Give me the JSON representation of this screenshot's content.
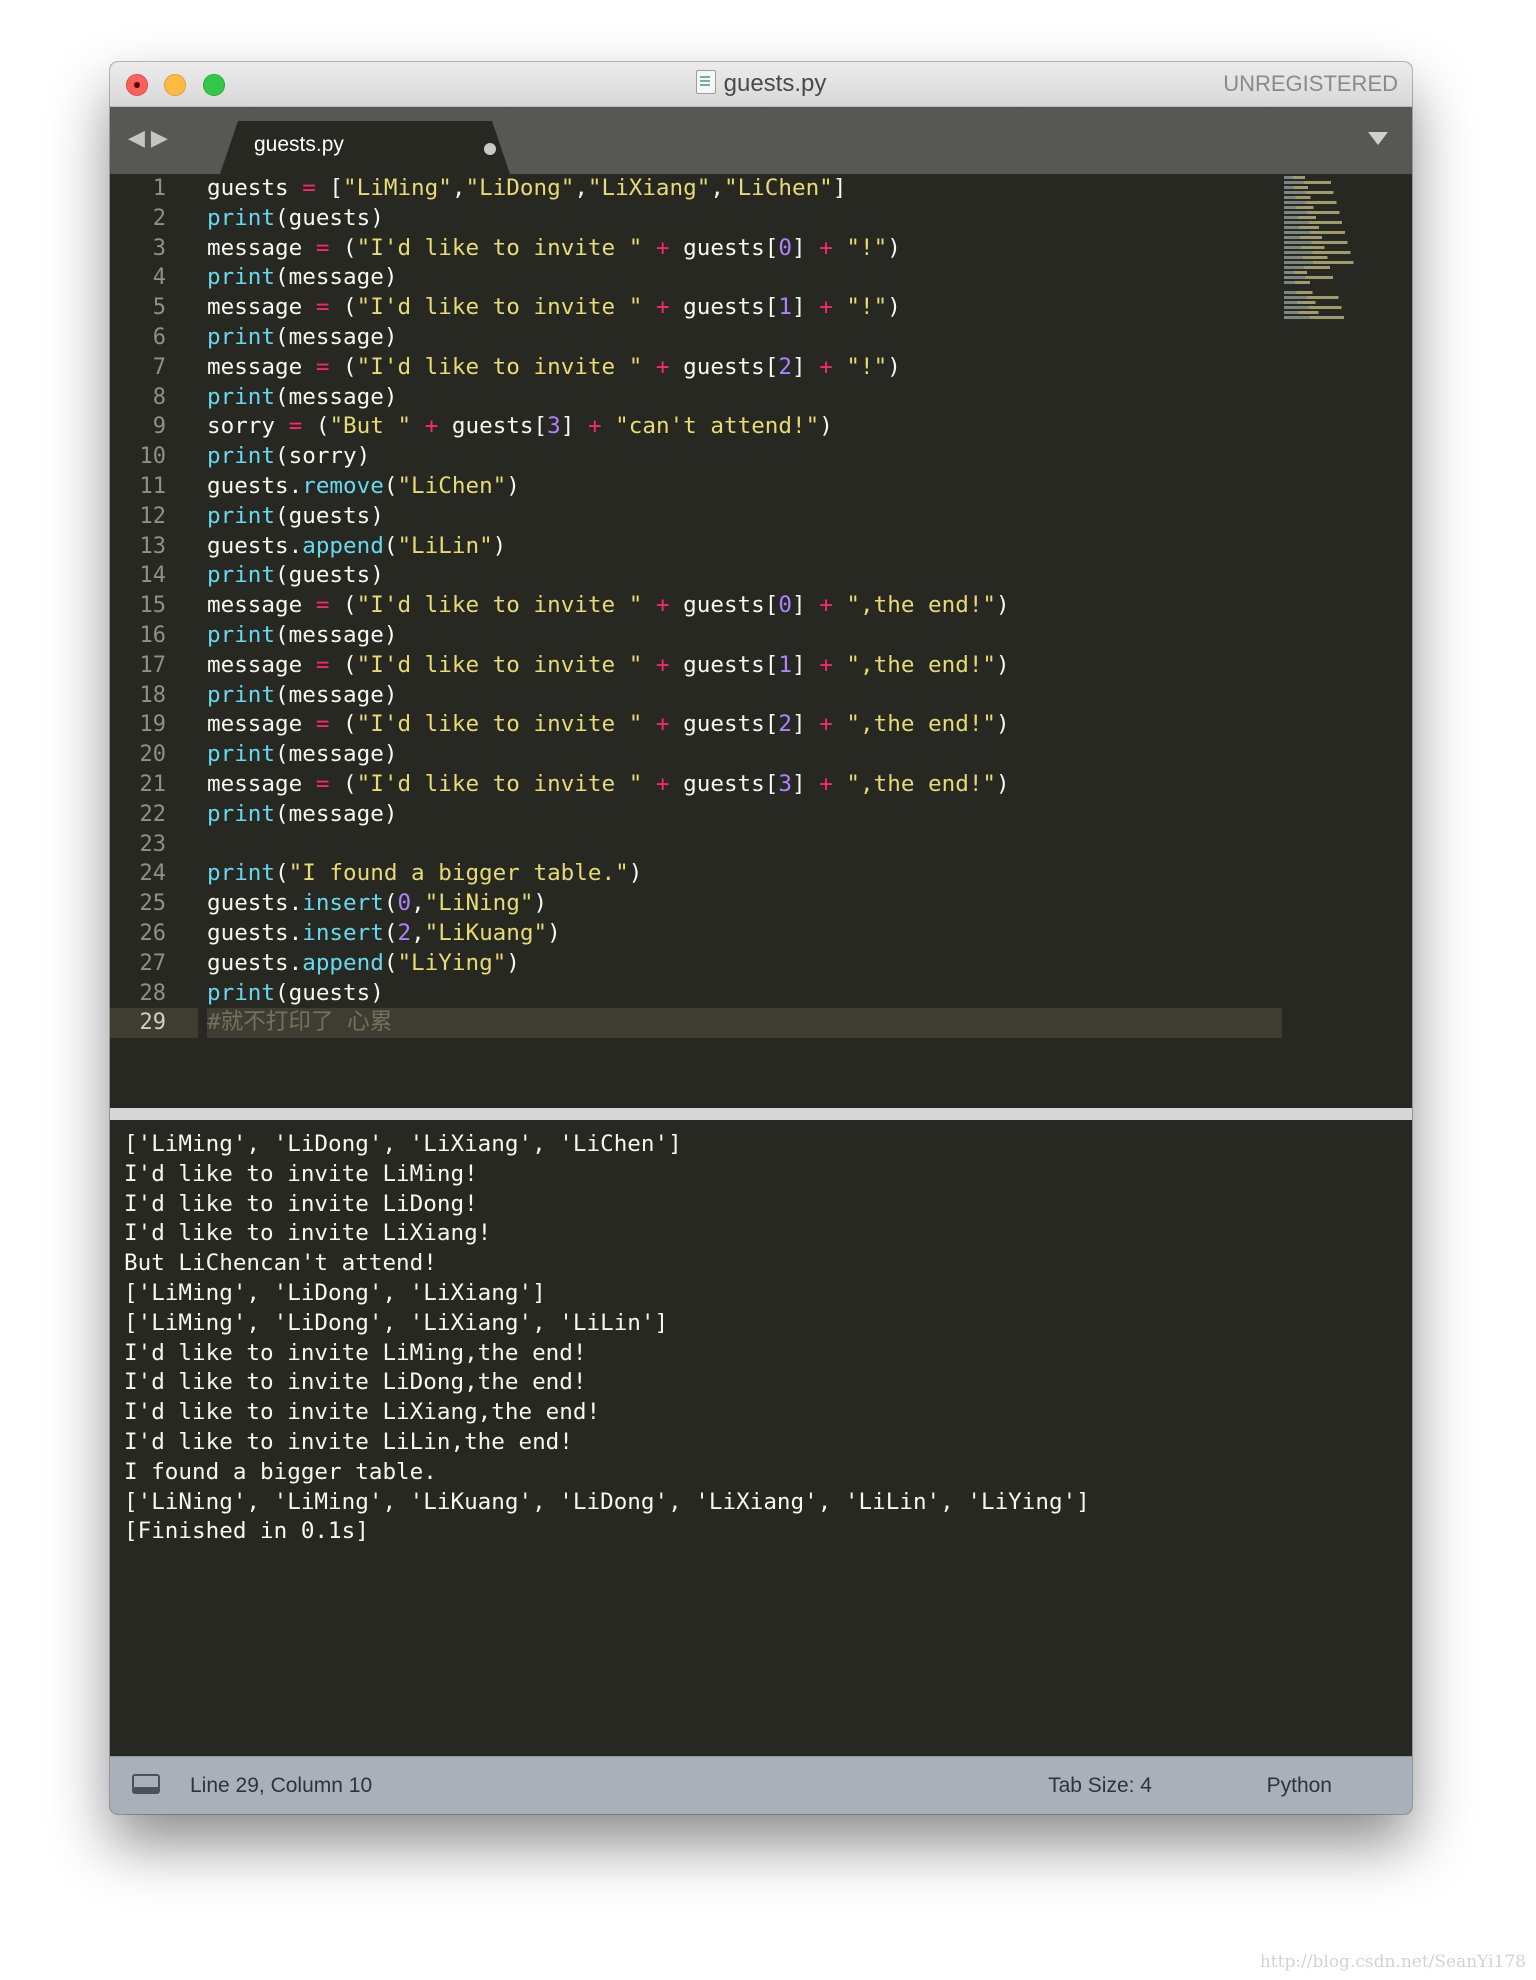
{
  "window": {
    "title": "guests.py",
    "license_status": "UNREGISTERED",
    "title_icon": "python-file-icon",
    "traffic_light_colors": [
      "#fc605c",
      "#fdbc40",
      "#34c84a"
    ]
  },
  "tabbar": {
    "nav_icon": "back-forward-arrows-icon",
    "tab_label": "guests.py",
    "tab_modified": true,
    "dropdown_icon": "tab-dropdown-icon"
  },
  "editor": {
    "theme_colors": {
      "background": "#272822",
      "string": "#e6db74",
      "keyword": "#f92672",
      "number": "#ae81ff",
      "builtin": "#66d9ef",
      "comment": "#75715e"
    },
    "active_line": 29,
    "lines": [
      {
        "n": "1",
        "tokens": [
          [
            "plain",
            "guests "
          ],
          [
            "op",
            "="
          ],
          [
            "plain",
            " ["
          ],
          [
            "str",
            "\"LiMing\""
          ],
          [
            "plain",
            ","
          ],
          [
            "str",
            "\"LiDong\""
          ],
          [
            "plain",
            ","
          ],
          [
            "str",
            "\"LiXiang\""
          ],
          [
            "plain",
            ","
          ],
          [
            "str",
            "\"LiChen\""
          ],
          [
            "plain",
            "]"
          ]
        ]
      },
      {
        "n": "2",
        "tokens": [
          [
            "fn",
            "print"
          ],
          [
            "plain",
            "(guests)"
          ]
        ]
      },
      {
        "n": "3",
        "tokens": [
          [
            "plain",
            "message "
          ],
          [
            "op",
            "="
          ],
          [
            "plain",
            " ("
          ],
          [
            "str",
            "\"I'd like to invite \""
          ],
          [
            "plain",
            " "
          ],
          [
            "op",
            "+"
          ],
          [
            "plain",
            " guests["
          ],
          [
            "num",
            "0"
          ],
          [
            "plain",
            "] "
          ],
          [
            "op",
            "+"
          ],
          [
            "plain",
            " "
          ],
          [
            "str",
            "\"!\""
          ],
          [
            "plain",
            ")"
          ]
        ]
      },
      {
        "n": "4",
        "tokens": [
          [
            "fn",
            "print"
          ],
          [
            "plain",
            "(message)"
          ]
        ]
      },
      {
        "n": "5",
        "tokens": [
          [
            "plain",
            "message "
          ],
          [
            "op",
            "="
          ],
          [
            "plain",
            " ("
          ],
          [
            "str",
            "\"I'd like to invite \""
          ],
          [
            "plain",
            " "
          ],
          [
            "op",
            "+"
          ],
          [
            "plain",
            " guests["
          ],
          [
            "num",
            "1"
          ],
          [
            "plain",
            "] "
          ],
          [
            "op",
            "+"
          ],
          [
            "plain",
            " "
          ],
          [
            "str",
            "\"!\""
          ],
          [
            "plain",
            ")"
          ]
        ]
      },
      {
        "n": "6",
        "tokens": [
          [
            "fn",
            "print"
          ],
          [
            "plain",
            "(message)"
          ]
        ]
      },
      {
        "n": "7",
        "tokens": [
          [
            "plain",
            "message "
          ],
          [
            "op",
            "="
          ],
          [
            "plain",
            " ("
          ],
          [
            "str",
            "\"I'd like to invite \""
          ],
          [
            "plain",
            " "
          ],
          [
            "op",
            "+"
          ],
          [
            "plain",
            " guests["
          ],
          [
            "num",
            "2"
          ],
          [
            "plain",
            "] "
          ],
          [
            "op",
            "+"
          ],
          [
            "plain",
            " "
          ],
          [
            "str",
            "\"!\""
          ],
          [
            "plain",
            ")"
          ]
        ]
      },
      {
        "n": "8",
        "tokens": [
          [
            "fn",
            "print"
          ],
          [
            "plain",
            "(message)"
          ]
        ]
      },
      {
        "n": "9",
        "tokens": [
          [
            "plain",
            "sorry "
          ],
          [
            "op",
            "="
          ],
          [
            "plain",
            " ("
          ],
          [
            "str",
            "\"But \""
          ],
          [
            "plain",
            " "
          ],
          [
            "op",
            "+"
          ],
          [
            "plain",
            " guests["
          ],
          [
            "num",
            "3"
          ],
          [
            "plain",
            "] "
          ],
          [
            "op",
            "+"
          ],
          [
            "plain",
            " "
          ],
          [
            "str",
            "\"can't attend!\""
          ],
          [
            "plain",
            ")"
          ]
        ]
      },
      {
        "n": "10",
        "tokens": [
          [
            "fn",
            "print"
          ],
          [
            "plain",
            "(sorry)"
          ]
        ]
      },
      {
        "n": "11",
        "tokens": [
          [
            "plain",
            "guests."
          ],
          [
            "fn",
            "remove"
          ],
          [
            "plain",
            "("
          ],
          [
            "str",
            "\"LiChen\""
          ],
          [
            "plain",
            ")"
          ]
        ]
      },
      {
        "n": "12",
        "tokens": [
          [
            "fn",
            "print"
          ],
          [
            "plain",
            "(guests)"
          ]
        ]
      },
      {
        "n": "13",
        "tokens": [
          [
            "plain",
            "guests."
          ],
          [
            "fn",
            "append"
          ],
          [
            "plain",
            "("
          ],
          [
            "str",
            "\"LiLin\""
          ],
          [
            "plain",
            ")"
          ]
        ]
      },
      {
        "n": "14",
        "tokens": [
          [
            "fn",
            "print"
          ],
          [
            "plain",
            "(guests)"
          ]
        ]
      },
      {
        "n": "15",
        "tokens": [
          [
            "plain",
            "message "
          ],
          [
            "op",
            "="
          ],
          [
            "plain",
            " ("
          ],
          [
            "str",
            "\"I'd like to invite \""
          ],
          [
            "plain",
            " "
          ],
          [
            "op",
            "+"
          ],
          [
            "plain",
            " guests["
          ],
          [
            "num",
            "0"
          ],
          [
            "plain",
            "] "
          ],
          [
            "op",
            "+"
          ],
          [
            "plain",
            " "
          ],
          [
            "str",
            "\",the end!\""
          ],
          [
            "plain",
            ")"
          ]
        ]
      },
      {
        "n": "16",
        "tokens": [
          [
            "fn",
            "print"
          ],
          [
            "plain",
            "(message)"
          ]
        ]
      },
      {
        "n": "17",
        "tokens": [
          [
            "plain",
            "message "
          ],
          [
            "op",
            "="
          ],
          [
            "plain",
            " ("
          ],
          [
            "str",
            "\"I'd like to invite \""
          ],
          [
            "plain",
            " "
          ],
          [
            "op",
            "+"
          ],
          [
            "plain",
            " guests["
          ],
          [
            "num",
            "1"
          ],
          [
            "plain",
            "] "
          ],
          [
            "op",
            "+"
          ],
          [
            "plain",
            " "
          ],
          [
            "str",
            "\",the end!\""
          ],
          [
            "plain",
            ")"
          ]
        ]
      },
      {
        "n": "18",
        "tokens": [
          [
            "fn",
            "print"
          ],
          [
            "plain",
            "(message)"
          ]
        ]
      },
      {
        "n": "19",
        "tokens": [
          [
            "plain",
            "message "
          ],
          [
            "op",
            "="
          ],
          [
            "plain",
            " ("
          ],
          [
            "str",
            "\"I'd like to invite \""
          ],
          [
            "plain",
            " "
          ],
          [
            "op",
            "+"
          ],
          [
            "plain",
            " guests["
          ],
          [
            "num",
            "2"
          ],
          [
            "plain",
            "] "
          ],
          [
            "op",
            "+"
          ],
          [
            "plain",
            " "
          ],
          [
            "str",
            "\",the end!\""
          ],
          [
            "plain",
            ")"
          ]
        ]
      },
      {
        "n": "20",
        "tokens": [
          [
            "fn",
            "print"
          ],
          [
            "plain",
            "(message)"
          ]
        ]
      },
      {
        "n": "21",
        "tokens": [
          [
            "plain",
            "message "
          ],
          [
            "op",
            "="
          ],
          [
            "plain",
            " ("
          ],
          [
            "str",
            "\"I'd like to invite \""
          ],
          [
            "plain",
            " "
          ],
          [
            "op",
            "+"
          ],
          [
            "plain",
            " guests["
          ],
          [
            "num",
            "3"
          ],
          [
            "plain",
            "] "
          ],
          [
            "op",
            "+"
          ],
          [
            "plain",
            " "
          ],
          [
            "str",
            "\",the end!\""
          ],
          [
            "plain",
            ")"
          ]
        ]
      },
      {
        "n": "22",
        "tokens": [
          [
            "fn",
            "print"
          ],
          [
            "plain",
            "(message)"
          ]
        ]
      },
      {
        "n": "23",
        "tokens": []
      },
      {
        "n": "24",
        "tokens": [
          [
            "fn",
            "print"
          ],
          [
            "plain",
            "("
          ],
          [
            "str",
            "\"I found a bigger table.\""
          ],
          [
            "plain",
            ")"
          ]
        ]
      },
      {
        "n": "25",
        "tokens": [
          [
            "plain",
            "guests."
          ],
          [
            "fn",
            "insert"
          ],
          [
            "plain",
            "("
          ],
          [
            "num",
            "0"
          ],
          [
            "plain",
            ","
          ],
          [
            "str",
            "\"LiNing\""
          ],
          [
            "plain",
            ")"
          ]
        ]
      },
      {
        "n": "26",
        "tokens": [
          [
            "plain",
            "guests."
          ],
          [
            "fn",
            "insert"
          ],
          [
            "plain",
            "("
          ],
          [
            "num",
            "2"
          ],
          [
            "plain",
            ","
          ],
          [
            "str",
            "\"LiKuang\""
          ],
          [
            "plain",
            ")"
          ]
        ]
      },
      {
        "n": "27",
        "tokens": [
          [
            "plain",
            "guests."
          ],
          [
            "fn",
            "append"
          ],
          [
            "plain",
            "("
          ],
          [
            "str",
            "\"LiYing\""
          ],
          [
            "plain",
            ")"
          ]
        ]
      },
      {
        "n": "28",
        "tokens": [
          [
            "fn",
            "print"
          ],
          [
            "plain",
            "(guests)"
          ]
        ]
      },
      {
        "n": "29",
        "tokens": [
          [
            "cmt",
            "#就不打印了 心累"
          ]
        ]
      }
    ]
  },
  "console": {
    "output": [
      "['LiMing', 'LiDong', 'LiXiang', 'LiChen']",
      "I'd like to invite LiMing!",
      "I'd like to invite LiDong!",
      "I'd like to invite LiXiang!",
      "But LiChencan't attend!",
      "['LiMing', 'LiDong', 'LiXiang']",
      "['LiMing', 'LiDong', 'LiXiang', 'LiLin']",
      "I'd like to invite LiMing,the end!",
      "I'd like to invite LiDong,the end!",
      "I'd like to invite LiXiang,the end!",
      "I'd like to invite LiLin,the end!",
      "I found a bigger table.",
      "['LiNing', 'LiMing', 'LiKuang', 'LiDong', 'LiXiang', 'LiLin', 'LiYing']",
      "[Finished in 0.1s]"
    ]
  },
  "statusbar": {
    "panel_icon": "toggle-panel-icon",
    "position": "Line 29, Column 10",
    "tab_size": "Tab Size: 4",
    "syntax": "Python"
  },
  "watermark": "http://blog.csdn.net/SeanYi178"
}
